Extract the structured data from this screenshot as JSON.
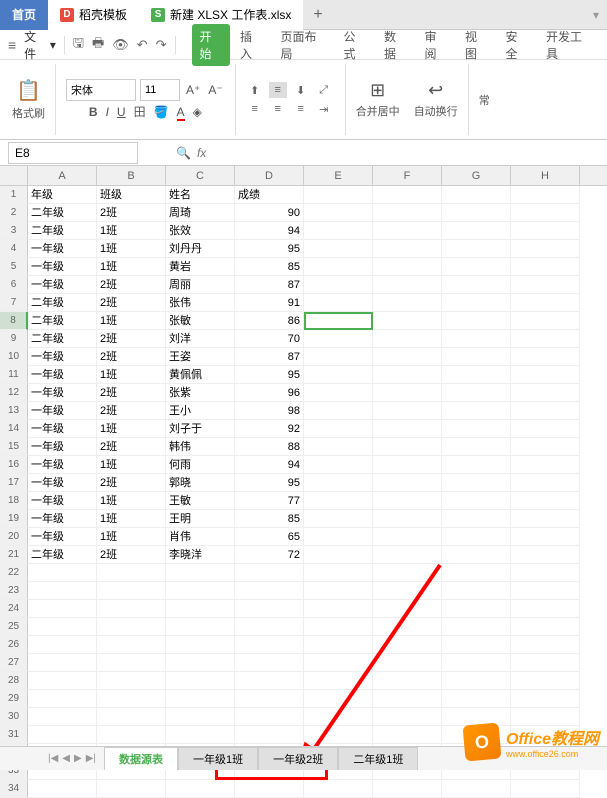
{
  "tabs": {
    "home": "首页",
    "docer": "稻壳模板",
    "file": "新建 XLSX 工作表.xlsx"
  },
  "file_menu": "文件",
  "ribbon_tabs": [
    "开始",
    "插入",
    "页面布局",
    "公式",
    "数据",
    "审阅",
    "视图",
    "安全",
    "开发工具"
  ],
  "active_ribbon": 0,
  "paste_label": "格式刷",
  "font_name": "宋体",
  "font_size": "11",
  "merge_label": "合并居中",
  "wrap_label": "自动换行",
  "common_label": "常",
  "name_box": "E8",
  "fx_label": "fx",
  "columns": [
    "A",
    "B",
    "C",
    "D",
    "E",
    "F",
    "G",
    "H"
  ],
  "headers": [
    "年级",
    "班级",
    "姓名",
    "成绩"
  ],
  "rows": [
    {
      "grade": "二年级",
      "class": "2班",
      "name": "周琦",
      "score": 90
    },
    {
      "grade": "二年级",
      "class": "1班",
      "name": "张效",
      "score": 94
    },
    {
      "grade": "一年级",
      "class": "1班",
      "name": "刘丹丹",
      "score": 95
    },
    {
      "grade": "一年级",
      "class": "1班",
      "name": "黄岩",
      "score": 85
    },
    {
      "grade": "一年级",
      "class": "2班",
      "name": "周丽",
      "score": 87
    },
    {
      "grade": "二年级",
      "class": "2班",
      "name": "张伟",
      "score": 91
    },
    {
      "grade": "二年级",
      "class": "1班",
      "name": "张敏",
      "score": 86
    },
    {
      "grade": "二年级",
      "class": "2班",
      "name": "刘洋",
      "score": 70
    },
    {
      "grade": "一年级",
      "class": "2班",
      "name": "王姿",
      "score": 87
    },
    {
      "grade": "一年级",
      "class": "1班",
      "name": "黄佩佩",
      "score": 95
    },
    {
      "grade": "一年级",
      "class": "2班",
      "name": "张紫",
      "score": 96
    },
    {
      "grade": "一年级",
      "class": "2班",
      "name": "王小",
      "score": 98
    },
    {
      "grade": "一年级",
      "class": "1班",
      "name": "刘子于",
      "score": 92
    },
    {
      "grade": "一年级",
      "class": "2班",
      "name": "韩伟",
      "score": 88
    },
    {
      "grade": "一年级",
      "class": "1班",
      "name": "何雨",
      "score": 94
    },
    {
      "grade": "一年级",
      "class": "2班",
      "name": "郭晓",
      "score": 95
    },
    {
      "grade": "一年级",
      "class": "1班",
      "name": "王敏",
      "score": 77
    },
    {
      "grade": "一年级",
      "class": "1班",
      "name": "王明",
      "score": 85
    },
    {
      "grade": "一年级",
      "class": "1班",
      "name": "肖伟",
      "score": 65
    },
    {
      "grade": "二年级",
      "class": "2班",
      "name": "李晓洋",
      "score": 72
    }
  ],
  "empty_rows": 13,
  "selected_row": 8,
  "sheet_tabs": [
    "数据源表",
    "一年级1班",
    "一年级2班",
    "二年级1班"
  ],
  "active_sheet": 0,
  "watermark": {
    "title": "Office教程网",
    "url": "www.office26.com",
    "icon": "O"
  }
}
